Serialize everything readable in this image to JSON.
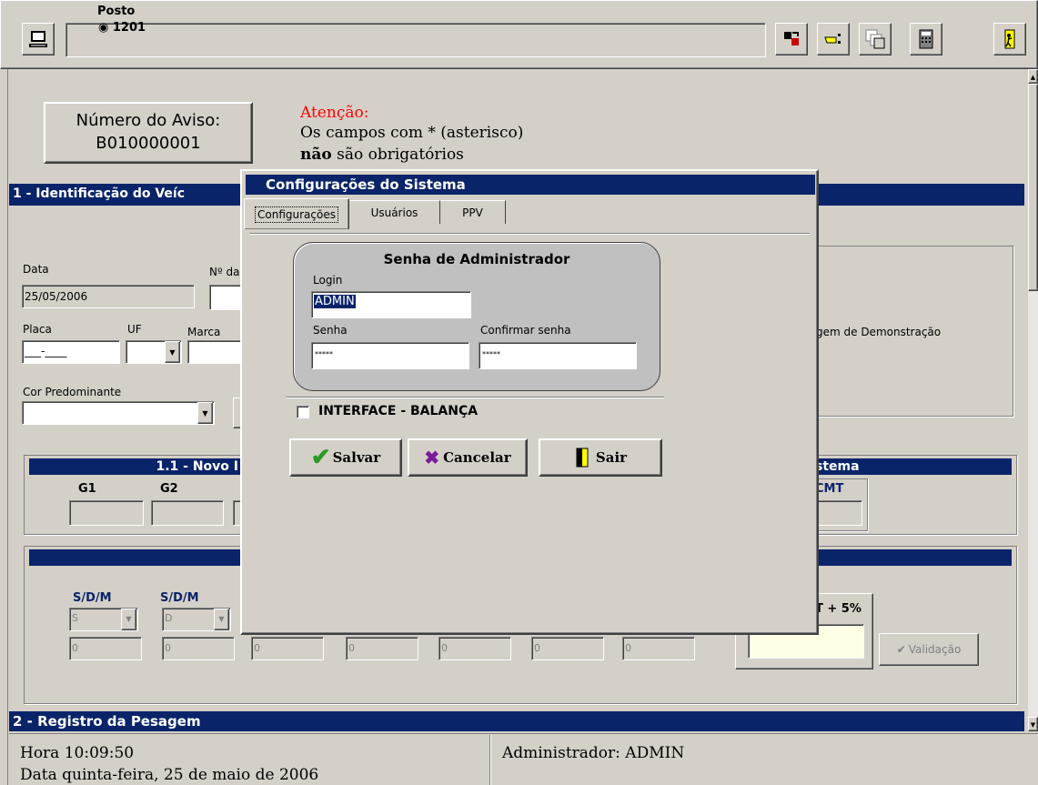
{
  "toolbar": {
    "posto_label": "Posto",
    "posto_value": "1201"
  },
  "aviso": {
    "label": "Número do Aviso:",
    "value": "B010000001"
  },
  "attention": {
    "title": "Atenção:",
    "line1": "Os campos com * (asterisco)",
    "line2_bold": "não",
    "line2_rest": " são obrigatórios"
  },
  "section1": {
    "title": "1 - Identificação do Veíc",
    "data_label": "Data",
    "data_value": "25/05/2006",
    "nro_label": "Nº da",
    "placa_label": "Placa",
    "placa_value": "___-____",
    "uf_label": "UF",
    "marca_label": "Marca",
    "cor_label": "Cor Predominante",
    "demo_text": "gem de Demonstração"
  },
  "subsection11": {
    "title": "1.1 - Novo I",
    "g1": "G1",
    "g2": "G2",
    "right_title": "stema",
    "cmt": "CMT"
  },
  "weights": {
    "sdm1_label": "S/D/M",
    "sdm1_value": "S",
    "sdm2_label": "S/D/M",
    "sdm2_value": "D",
    "values": [
      "0",
      "0",
      "0",
      "0",
      "0",
      "0",
      "0"
    ],
    "cmt5_label": "T + 5%",
    "validacao": "Validação"
  },
  "section2": {
    "title": "2 - Registro da Pesagem"
  },
  "status": {
    "hora": "Hora 10:09:50",
    "data": "Data  quinta-feira, 25 de maio de 2006",
    "user": "Administrador: ADMIN"
  },
  "dialog": {
    "title": "Configurações do Sistema",
    "tabs": [
      "Configurações",
      "Usuários",
      "PPV"
    ],
    "group_title": "Senha de Administrador",
    "login_label": "Login",
    "login_value": "ADMIN",
    "senha_label": "Senha",
    "senha_value": "*****",
    "confirm_label": "Confirmar senha",
    "confirm_value": "*****",
    "interface_label": "INTERFACE - BALANÇA",
    "save": "Salvar",
    "cancel": "Cancelar",
    "exit": "Sair"
  }
}
